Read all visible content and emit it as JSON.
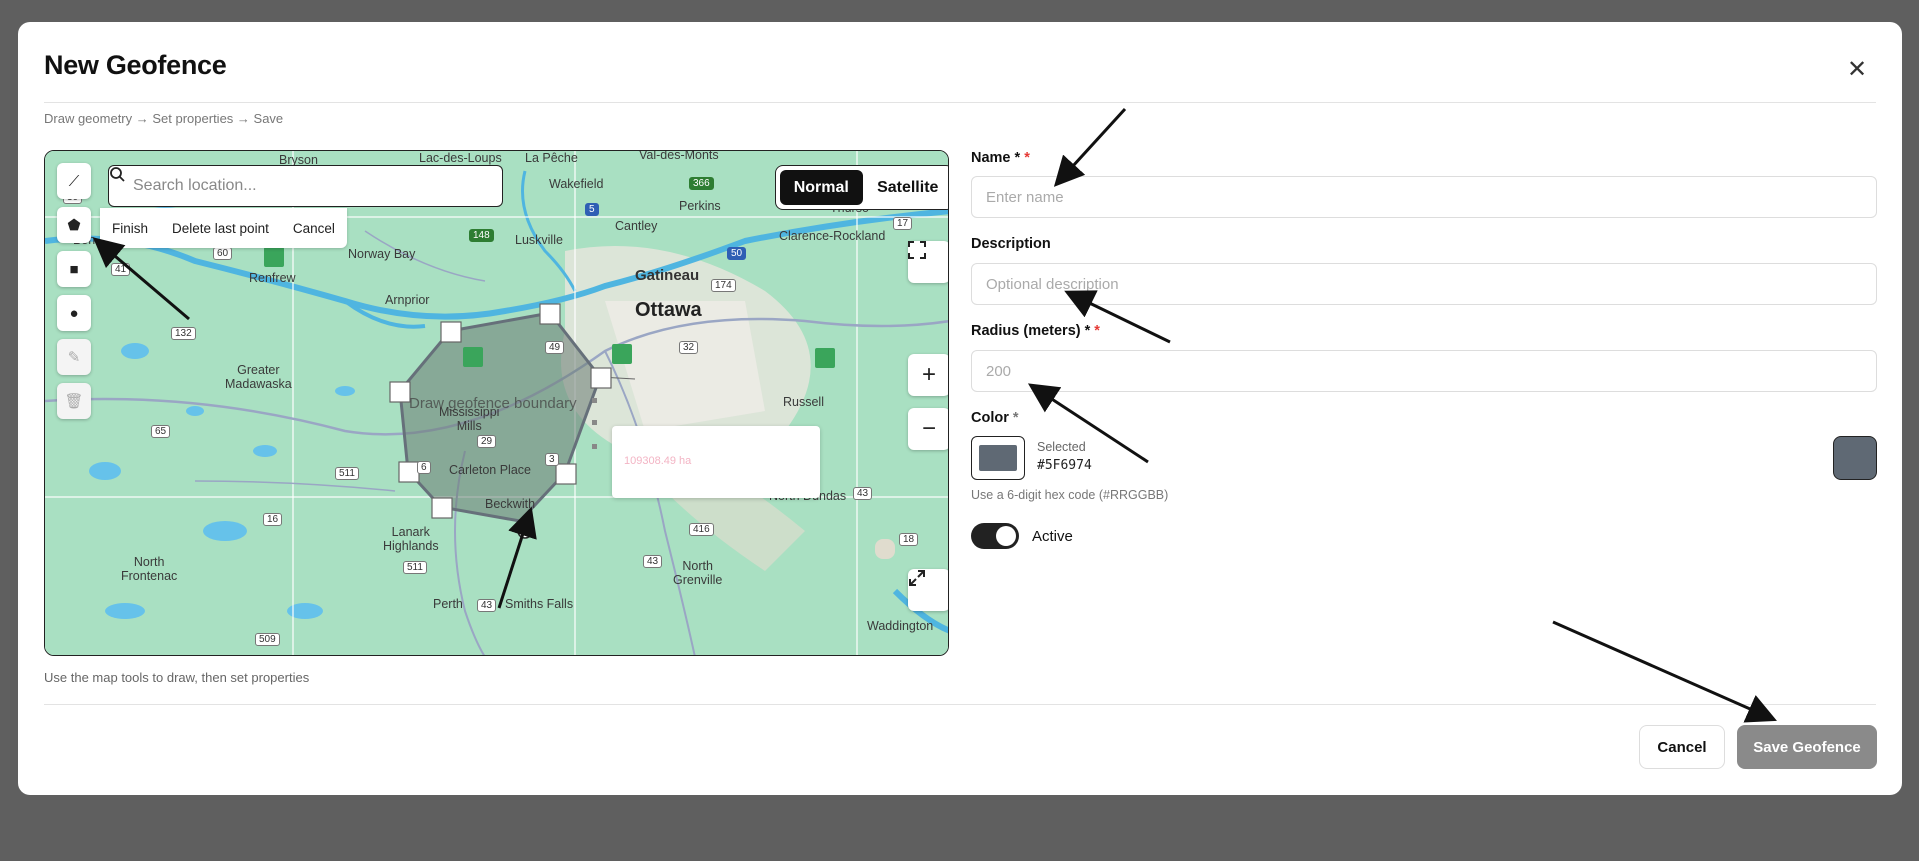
{
  "modal": {
    "title": "New Geofence",
    "steps": "Draw geometry → Set properties → Save",
    "map_help": "Use the map tools to draw, then set properties"
  },
  "map": {
    "search_placeholder": "Search location...",
    "draw_actions": {
      "finish": "Finish",
      "delete_last": "Delete last point",
      "cancel": "Cancel"
    },
    "basemap": {
      "normal": "Normal",
      "satellite": "Satellite",
      "selected": "Normal"
    },
    "draw_hint": "Draw geofence boundary",
    "area_label": "109308.49 ha",
    "places": {
      "bryson": "Bryson",
      "lac_des_loups": "Lac-des-Loups",
      "la_peche": "La Pêche",
      "val_des_monts": "Val-des-Monts",
      "wakefield": "Wakefield",
      "perkins": "Perkins",
      "thurso": "Thurso",
      "cantley": "Cantley",
      "clarence_rockland": "Clarence-Rockland",
      "norway_bay": "Norway Bay",
      "luskville": "Luskville",
      "renfrew": "Renfrew",
      "gatineau": "Gatineau",
      "ottawa": "Ottawa",
      "arnprior": "Arnprior",
      "greater_madawaska": "Greater\nMadawaska",
      "mississippi_mills": "Mississippi\nMills",
      "carleton_place": "Carleton Place",
      "russell": "Russell",
      "beckwith": "Beckwith",
      "lanark_highlands": "Lanark\nHighlands",
      "north_frontenac": "North\nFrontenac",
      "perth": "Perth",
      "smiths_falls": "Smiths Falls",
      "north_grenville": "North\nGrenville",
      "north_dundas": "North Dundas",
      "waddington": "Waddington",
      "bon": "Bon"
    },
    "shields": [
      "30",
      "41",
      "60",
      "132",
      "148",
      "5",
      "366",
      "50",
      "17",
      "174",
      "49",
      "32",
      "65",
      "511",
      "29",
      "3",
      "6",
      "16",
      "511",
      "509",
      "43",
      "416",
      "43",
      "18",
      "43",
      "43"
    ]
  },
  "form": {
    "name_label": "Name *",
    "name_required": "*",
    "name_placeholder": "Enter name",
    "description_label": "Description",
    "description_placeholder": "Optional description",
    "radius_label": "Radius (meters) *",
    "radius_required": "*",
    "radius_placeholder": "200",
    "color_label": "Color",
    "color_required": "*",
    "color_selected_label": "Selected",
    "color_value": "#5F6974",
    "color_help": "Use a 6-digit hex code (#RRGGBB)",
    "active_label": "Active",
    "active": true
  },
  "footer": {
    "cancel": "Cancel",
    "save": "Save Geofence"
  },
  "colors": {
    "selected_swatch": "#5F6974",
    "save_button_disabled": "#8a8a8a",
    "map_land": "#aee3c6",
    "polygon_fill": "#6b7b74"
  },
  "icons": {
    "search": "search-icon",
    "close": "close-icon",
    "line_tool": "line-tool-icon",
    "polygon_tool": "polygon-tool-icon",
    "rectangle_tool": "rectangle-tool-icon",
    "circle_tool": "circle-tool-icon",
    "edit_tool": "edit-icon",
    "delete_tool": "trash-icon",
    "fullscreen": "fullscreen-icon",
    "zoom_in": "plus-icon",
    "zoom_out": "minus-icon",
    "expand": "expand-icon"
  }
}
